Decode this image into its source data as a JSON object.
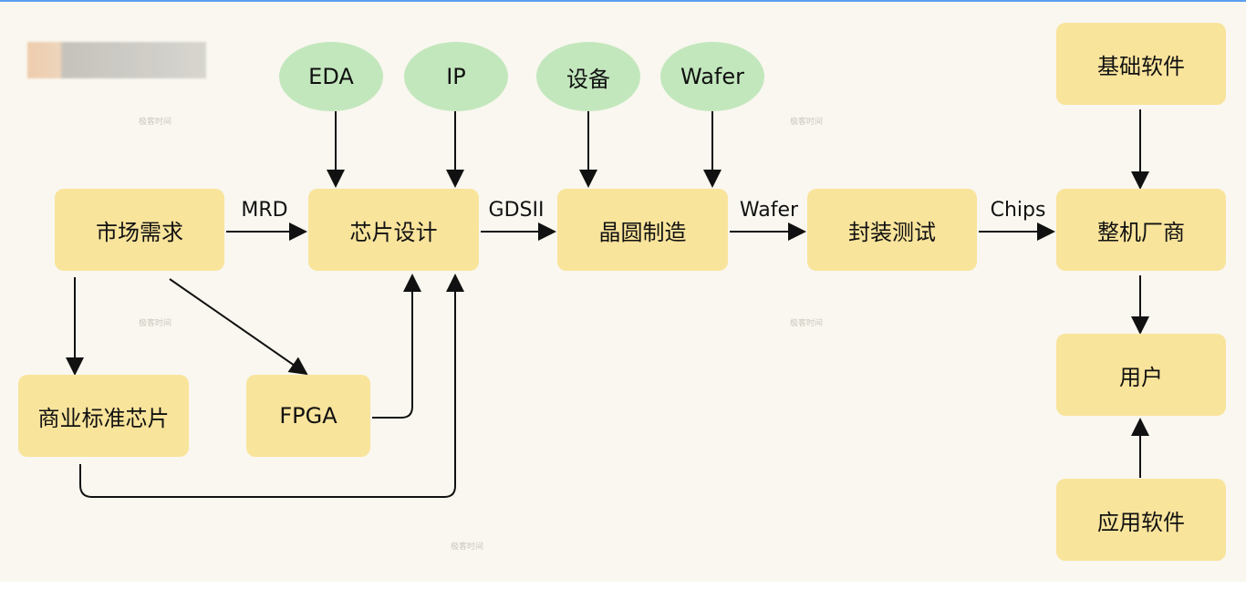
{
  "nodes": {
    "market": "市场需求",
    "design": "芯片设计",
    "fab": "晶圆制造",
    "packaging": "封装测试",
    "oem": "整机厂商",
    "base_software": "基础软件",
    "user": "用户",
    "app_software": "应用软件",
    "standard_chip": "商业标准芯片",
    "fpga": "FPGA"
  },
  "inputs": {
    "eda": "EDA",
    "ip": "IP",
    "equipment": "设备",
    "wafer": "Wafer"
  },
  "edge_labels": {
    "mrd": "MRD",
    "gdsii": "GDSII",
    "wafer": "Wafer",
    "chips": "Chips"
  },
  "watermark": "极客时间",
  "colors": {
    "process_box": "#f9e49c",
    "input_ellipse": "#c3e7bd",
    "background": "#f9f7ef",
    "top_border": "#5aa0f0"
  }
}
